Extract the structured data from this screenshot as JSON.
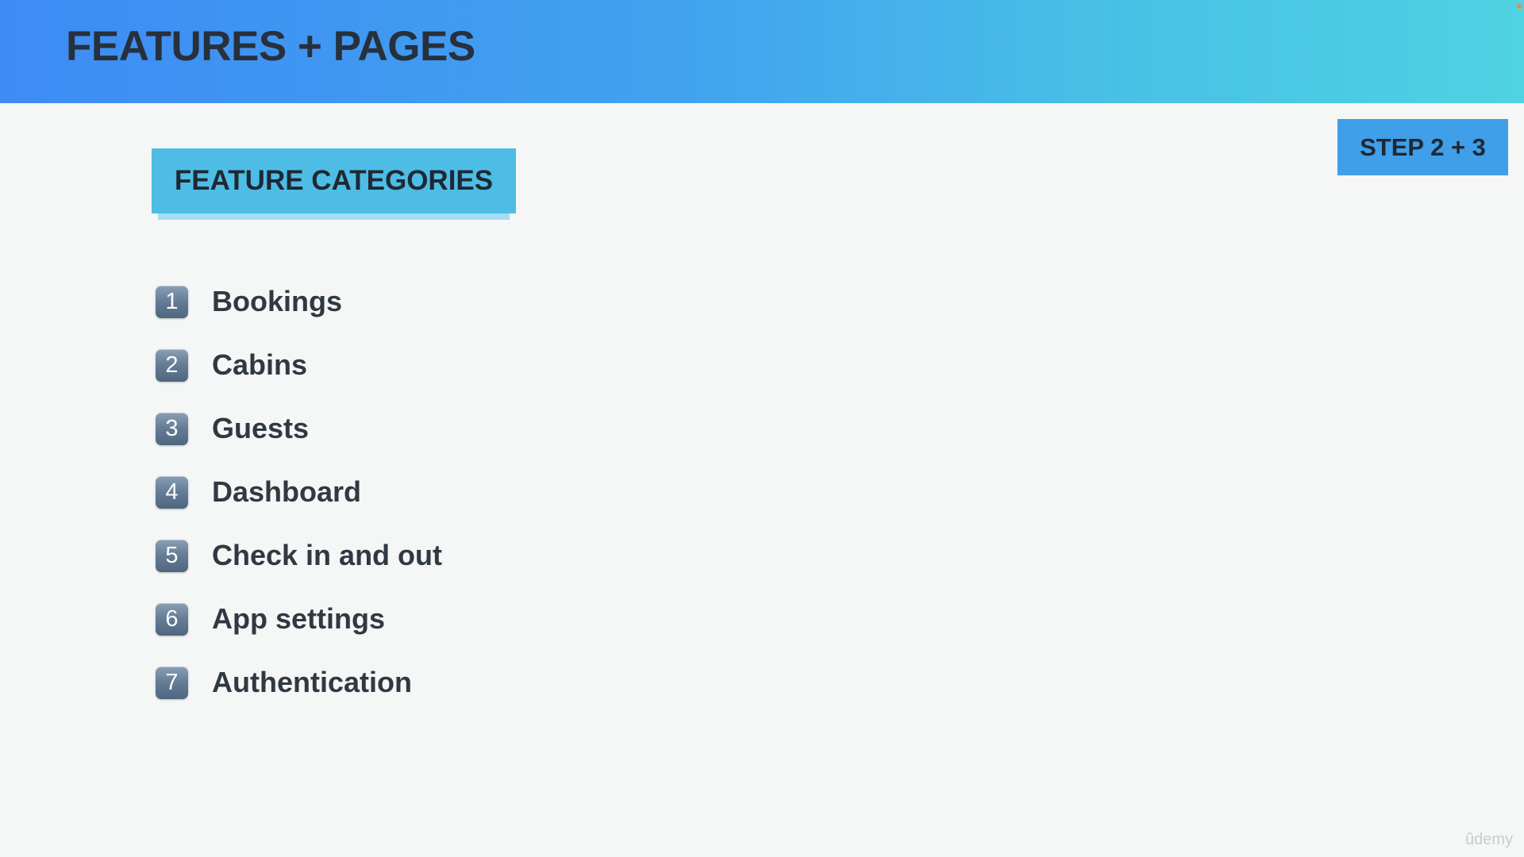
{
  "header": {
    "title": "FEATURES + PAGES"
  },
  "step_badge": {
    "label": "STEP 2 + 3"
  },
  "section": {
    "label": "FEATURE CATEGORIES"
  },
  "features": [
    {
      "number": "1",
      "label": "Bookings"
    },
    {
      "number": "2",
      "label": "Cabins"
    },
    {
      "number": "3",
      "label": "Guests"
    },
    {
      "number": "4",
      "label": "Dashboard"
    },
    {
      "number": "5",
      "label": "Check in and out"
    },
    {
      "number": "6",
      "label": "App settings"
    },
    {
      "number": "7",
      "label": "Authentication"
    }
  ],
  "watermark": "ûdemy",
  "colors": {
    "header_gradient_start": "#3e8bf4",
    "header_gradient_end": "#4fd2e2",
    "category_label_bg": "#4dbde6",
    "step_badge_bg": "#3f9fe9",
    "text_dark": "#27303c",
    "background": "#f5f6f6"
  }
}
